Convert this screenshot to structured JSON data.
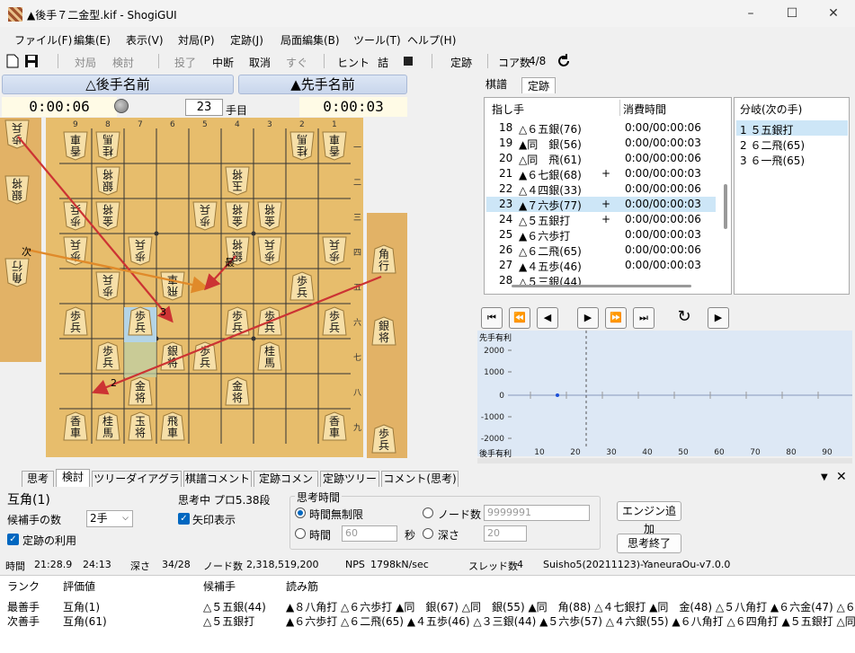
{
  "window": {
    "title": "▲後手７二金型.kif - ShogiGUI",
    "minimize": "–",
    "maximize": "☐",
    "close": "✕"
  },
  "menu": [
    "ファイル(F)",
    "編集(E)",
    "表示(V)",
    "対局(P)",
    "定跡(J)",
    "局面編集(B)",
    "ツール(T)",
    "ヘルプ(H)"
  ],
  "toolbar": {
    "taikyoku": "対局",
    "kento": "検討",
    "touryo": "投了",
    "chudan": "中断",
    "torikeshi": "取消",
    "sugu": "すぐ",
    "hint": "ヒント",
    "tsume": "詰",
    "joseki": "定跡",
    "core": "コア数",
    "core_val": "4/8"
  },
  "players": {
    "gote": "△後手名前",
    "sente": "▲先手名前",
    "gote_time": "0:00:06",
    "sente_time": "0:00:03",
    "move_no": "23",
    "move_unit": "手目"
  },
  "board": {
    "cols": [
      "9",
      "8",
      "7",
      "6",
      "5",
      "4",
      "3",
      "2",
      "1"
    ],
    "rows": [
      "一",
      "二",
      "三",
      "四",
      "五",
      "六",
      "七",
      "八",
      "九"
    ],
    "pieces": [
      {
        "c": 1,
        "r": 1,
        "k": "香車",
        "g": true
      },
      {
        "c": 2,
        "r": 1,
        "k": "桂馬",
        "g": true
      },
      {
        "c": 8,
        "r": 1,
        "k": "桂馬",
        "g": true
      },
      {
        "c": 9,
        "r": 1,
        "k": "香車",
        "g": true
      },
      {
        "c": 4,
        "r": 2,
        "k": "玉将",
        "g": true
      },
      {
        "c": 8,
        "r": 2,
        "k": "銀将",
        "g": true
      },
      {
        "c": 3,
        "r": 3,
        "k": "金将",
        "g": true
      },
      {
        "c": 4,
        "r": 3,
        "k": "金将",
        "g": true
      },
      {
        "c": 5,
        "r": 3,
        "k": "歩兵",
        "g": true
      },
      {
        "c": 8,
        "r": 3,
        "k": "金将",
        "g": true
      },
      {
        "c": 9,
        "r": 3,
        "k": "歩兵",
        "g": true
      },
      {
        "c": 1,
        "r": 4,
        "k": "歩兵",
        "g": true
      },
      {
        "c": 3,
        "r": 4,
        "k": "歩兵",
        "g": true
      },
      {
        "c": 4,
        "r": 4,
        "k": "銀将",
        "g": true
      },
      {
        "c": 7,
        "r": 4,
        "k": "歩兵",
        "g": true
      },
      {
        "c": 9,
        "r": 4,
        "k": "歩兵",
        "g": true
      },
      {
        "c": 6,
        "r": 5,
        "k": "飛車",
        "g": true
      },
      {
        "c": 8,
        "r": 5,
        "k": "歩兵",
        "g": true
      },
      {
        "c": 2,
        "r": 5,
        "k": "歩兵",
        "g": false
      },
      {
        "c": 1,
        "r": 6,
        "k": "歩兵",
        "g": false
      },
      {
        "c": 3,
        "r": 6,
        "k": "歩兵",
        "g": false
      },
      {
        "c": 4,
        "r": 6,
        "k": "歩兵",
        "g": false
      },
      {
        "c": 7,
        "r": 6,
        "k": "歩兵",
        "g": false
      },
      {
        "c": 9,
        "r": 6,
        "k": "歩兵",
        "g": false
      },
      {
        "c": 3,
        "r": 7,
        "k": "桂馬",
        "g": false
      },
      {
        "c": 5,
        "r": 7,
        "k": "歩兵",
        "g": false
      },
      {
        "c": 6,
        "r": 7,
        "k": "銀将",
        "g": false
      },
      {
        "c": 8,
        "r": 7,
        "k": "歩兵",
        "g": false
      },
      {
        "c": 4,
        "r": 8,
        "k": "金将",
        "g": false
      },
      {
        "c": 7,
        "r": 8,
        "k": "金将",
        "g": false
      },
      {
        "c": 1,
        "r": 9,
        "k": "香車",
        "g": false
      },
      {
        "c": 6,
        "r": 9,
        "k": "飛車",
        "g": false
      },
      {
        "c": 7,
        "r": 9,
        "k": "玉将",
        "g": false
      },
      {
        "c": 8,
        "r": 9,
        "k": "桂馬",
        "g": false
      },
      {
        "c": 9,
        "r": 9,
        "k": "香車",
        "g": false
      }
    ],
    "gote_hand": [
      "歩兵",
      "銀将",
      "角行"
    ],
    "sente_hand": [
      "角行",
      "銀将",
      "歩兵"
    ],
    "arrow_labels": {
      "next": "次",
      "best": "最",
      "n2": "2",
      "n3": "3"
    }
  },
  "tabs_right": {
    "kifu": "棋譜",
    "joseki": "定跡"
  },
  "kifu": {
    "col_move": "指し手",
    "col_time": "消費時間",
    "rows": [
      {
        "n": "18",
        "m": "△６五銀(76)",
        "t": "0:00/00:00:06",
        "mark": ""
      },
      {
        "n": "19",
        "m": "▲同　銀(56)",
        "t": "0:00/00:00:03",
        "mark": ""
      },
      {
        "n": "20",
        "m": "△同　飛(61)",
        "t": "0:00/00:00:06",
        "mark": ""
      },
      {
        "n": "21",
        "m": "▲６七銀(68)",
        "t": "0:00/00:00:03",
        "mark": "+"
      },
      {
        "n": "22",
        "m": "△４四銀(33)",
        "t": "0:00/00:00:06",
        "mark": ""
      },
      {
        "n": "23",
        "m": "▲７六歩(77)",
        "t": "0:00/00:00:03",
        "mark": "+"
      },
      {
        "n": "24",
        "m": "△５五銀打",
        "t": "0:00/00:00:06",
        "mark": "+"
      },
      {
        "n": "25",
        "m": "▲６六歩打",
        "t": "0:00/00:00:03",
        "mark": ""
      },
      {
        "n": "26",
        "m": "△６二飛(65)",
        "t": "0:00/00:00:06",
        "mark": ""
      },
      {
        "n": "27",
        "m": "▲４五歩(46)",
        "t": "0:00/00:00:03",
        "mark": ""
      },
      {
        "n": "28",
        "m": "△５三銀(44)",
        "t": "",
        "mark": ""
      }
    ]
  },
  "branch": {
    "title": "分岐(次の手)",
    "items": [
      "1 ５五銀打",
      "2 ６二飛(65)",
      "3 ６一飛(65)"
    ]
  },
  "graph": {
    "top": "先手有利",
    "bottom": "後手有利",
    "yticks": [
      "2000",
      "1000",
      "0",
      "-1000",
      "-2000"
    ],
    "xticks": [
      "10",
      "20",
      "30",
      "40",
      "50",
      "60",
      "70",
      "80",
      "90"
    ]
  },
  "tabs_bottom": [
    "思考",
    "検討",
    "ツリーダイアグラム",
    "棋譜コメント",
    "定跡コメント",
    "定跡ツリー",
    "コメント(思考)"
  ],
  "analysis": {
    "eval": "互角(1)",
    "candidates_label": "候補手の数",
    "candidates_val": "2手",
    "use_joseki": "定跡の利用",
    "status": "思考中 プロ5.38段",
    "show_arrow": "矢印表示",
    "think_time": "思考時間",
    "unlimited": "時間無制限",
    "time": "時間",
    "time_val": "60",
    "sec": "秒",
    "nodes": "ノード数",
    "nodes_val": "9999991",
    "depth": "深さ",
    "depth_val": "20",
    "add_engine": "エンジン追加",
    "stop": "思考終了",
    "info": {
      "time_label": "時間",
      "time1": "21:28.9",
      "time2": "24:13",
      "depth_label": "深さ",
      "depth": "34/28",
      "node_label": "ノード数",
      "nodes": "2,318,519,200",
      "nps_label": "NPS",
      "nps": "1798kN/sec",
      "thread_label": "スレッド数",
      "threads": "4",
      "engine": "Suisho5(20211123)-YaneuraOu-v7.0.0"
    }
  },
  "pv": {
    "head": [
      "ランク",
      "評価値",
      "候補手",
      "読み筋"
    ],
    "rows": [
      {
        "rank": "最善手",
        "eval": "互角(1)",
        "move": "△５五銀(44)",
        "line": "▲８八角打 △６六歩打 ▲同　銀(67) △同　銀(55) ▲同　角(88) △４七銀打 ▲同　金(48) △５八角打 ▲６六金(47) △６九..."
      },
      {
        "rank": "次善手",
        "eval": "互角(61)",
        "move": "△５五銀打",
        "line": "▲６六歩打 △６二飛(65) ▲４五歩(46) △３三銀(44) ▲５六歩(57) △４六銀(55) ▲６八角打 △６四角打 ▲５五銀打 △同..."
      }
    ]
  }
}
